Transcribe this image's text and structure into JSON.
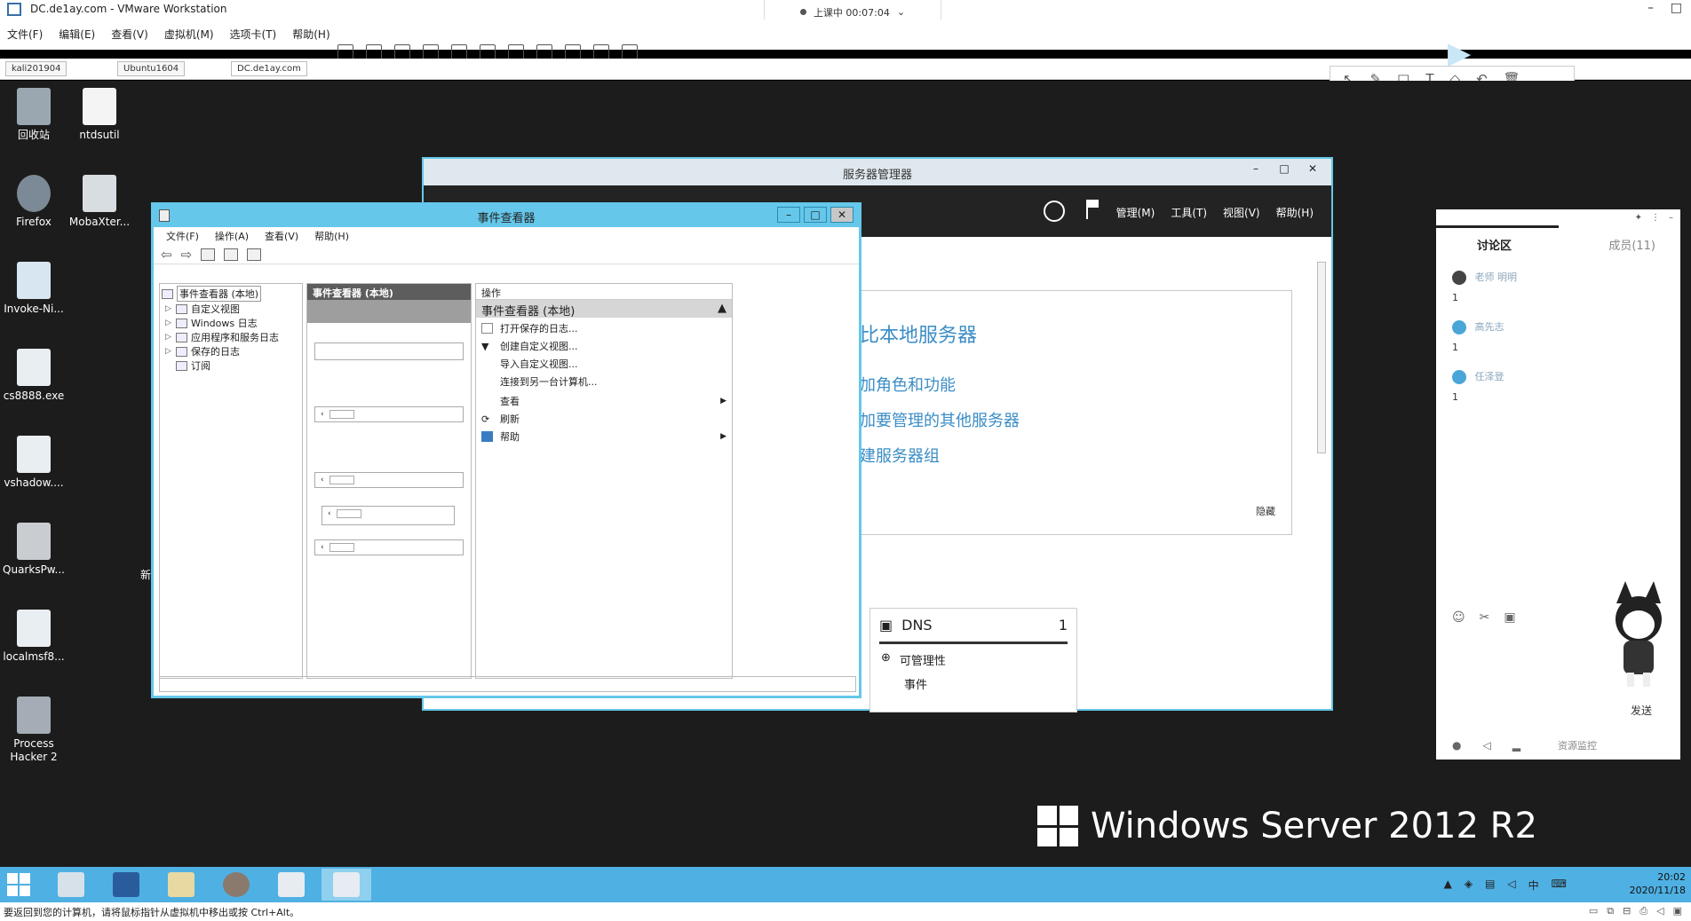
{
  "vmware": {
    "title": "DC.de1ay.com - VMware Workstation",
    "menu": [
      "文件(F)",
      "编辑(E)",
      "查看(V)",
      "虚拟机(M)",
      "选项卡(T)",
      "帮助(H)"
    ],
    "tabs": [
      "kali201904",
      "Ubuntu1604",
      "DC.de1ay.com"
    ],
    "status_text": "要返回到您的计算机，请将鼠标指针从虚拟机中移出或按 Ctrl+Alt。"
  },
  "recording": {
    "label": "上课中 00:07:04"
  },
  "desktop": {
    "icons": [
      {
        "label": "回收站"
      },
      {
        "label": "ntdsutil"
      },
      {
        "label": "Firefox"
      },
      {
        "label": "MobaXter..."
      },
      {
        "label": "Invoke-Ni..."
      },
      {
        "label": "cs8888.exe"
      },
      {
        "label": "vshadow...."
      },
      {
        "label": "QuarksPw..."
      },
      {
        "label": "localmsf8..."
      },
      {
        "label": "Process Hacker 2"
      }
    ],
    "partial_label": "新",
    "watermark": "Windows Server 2012 R2"
  },
  "server_manager": {
    "title": "服务器管理器",
    "menus": [
      "管理(M)",
      "工具(T)",
      "视图(V)",
      "帮助(H)"
    ],
    "welcome_title": "比本地服务器",
    "links": [
      "加角色和功能",
      "加要管理的其他服务器",
      "建服务器组"
    ],
    "hide_label": "隐藏",
    "dns_label": "DNS",
    "dns_count": "1",
    "dns_rows": [
      "可管理性",
      "事件"
    ]
  },
  "event_viewer": {
    "title": "事件查看器",
    "menu": [
      "文件(F)",
      "操作(A)",
      "查看(V)",
      "帮助(H)"
    ],
    "tree": [
      {
        "label": "事件查看器 (本地)"
      },
      {
        "label": "自定义视图"
      },
      {
        "label": "Windows 日志"
      },
      {
        "label": "应用程序和服务日志"
      },
      {
        "label": "保存的日志"
      },
      {
        "label": "订阅"
      }
    ],
    "middle_header": "事件查看器 (本地)",
    "actions_header": "操作",
    "actions_section": "事件查看器 (本地)",
    "actions": [
      {
        "label": "打开保存的日志..."
      },
      {
        "label": "创建自定义视图..."
      },
      {
        "label": "导入自定义视图..."
      },
      {
        "label": "连接到另一台计算机..."
      },
      {
        "label": "查看"
      },
      {
        "label": "刷新"
      },
      {
        "label": "帮助"
      }
    ]
  },
  "chat": {
    "tab_discussion": "讨论区",
    "tab_members": "成员(11)",
    "messages": [
      {
        "badge": "老师",
        "name": "明明",
        "text": "1"
      },
      {
        "name": "高先志",
        "text": "1"
      },
      {
        "name": "任泽登",
        "text": "1"
      }
    ],
    "send_label": "发送",
    "resource_label": "资源监控"
  },
  "taskbar": {
    "time": "20:02",
    "date": "2020/11/18",
    "ime": "中"
  },
  "colors": {
    "accent": "#65c7ea",
    "taskbar": "#4fb0e3",
    "link": "#3b8dc6"
  }
}
